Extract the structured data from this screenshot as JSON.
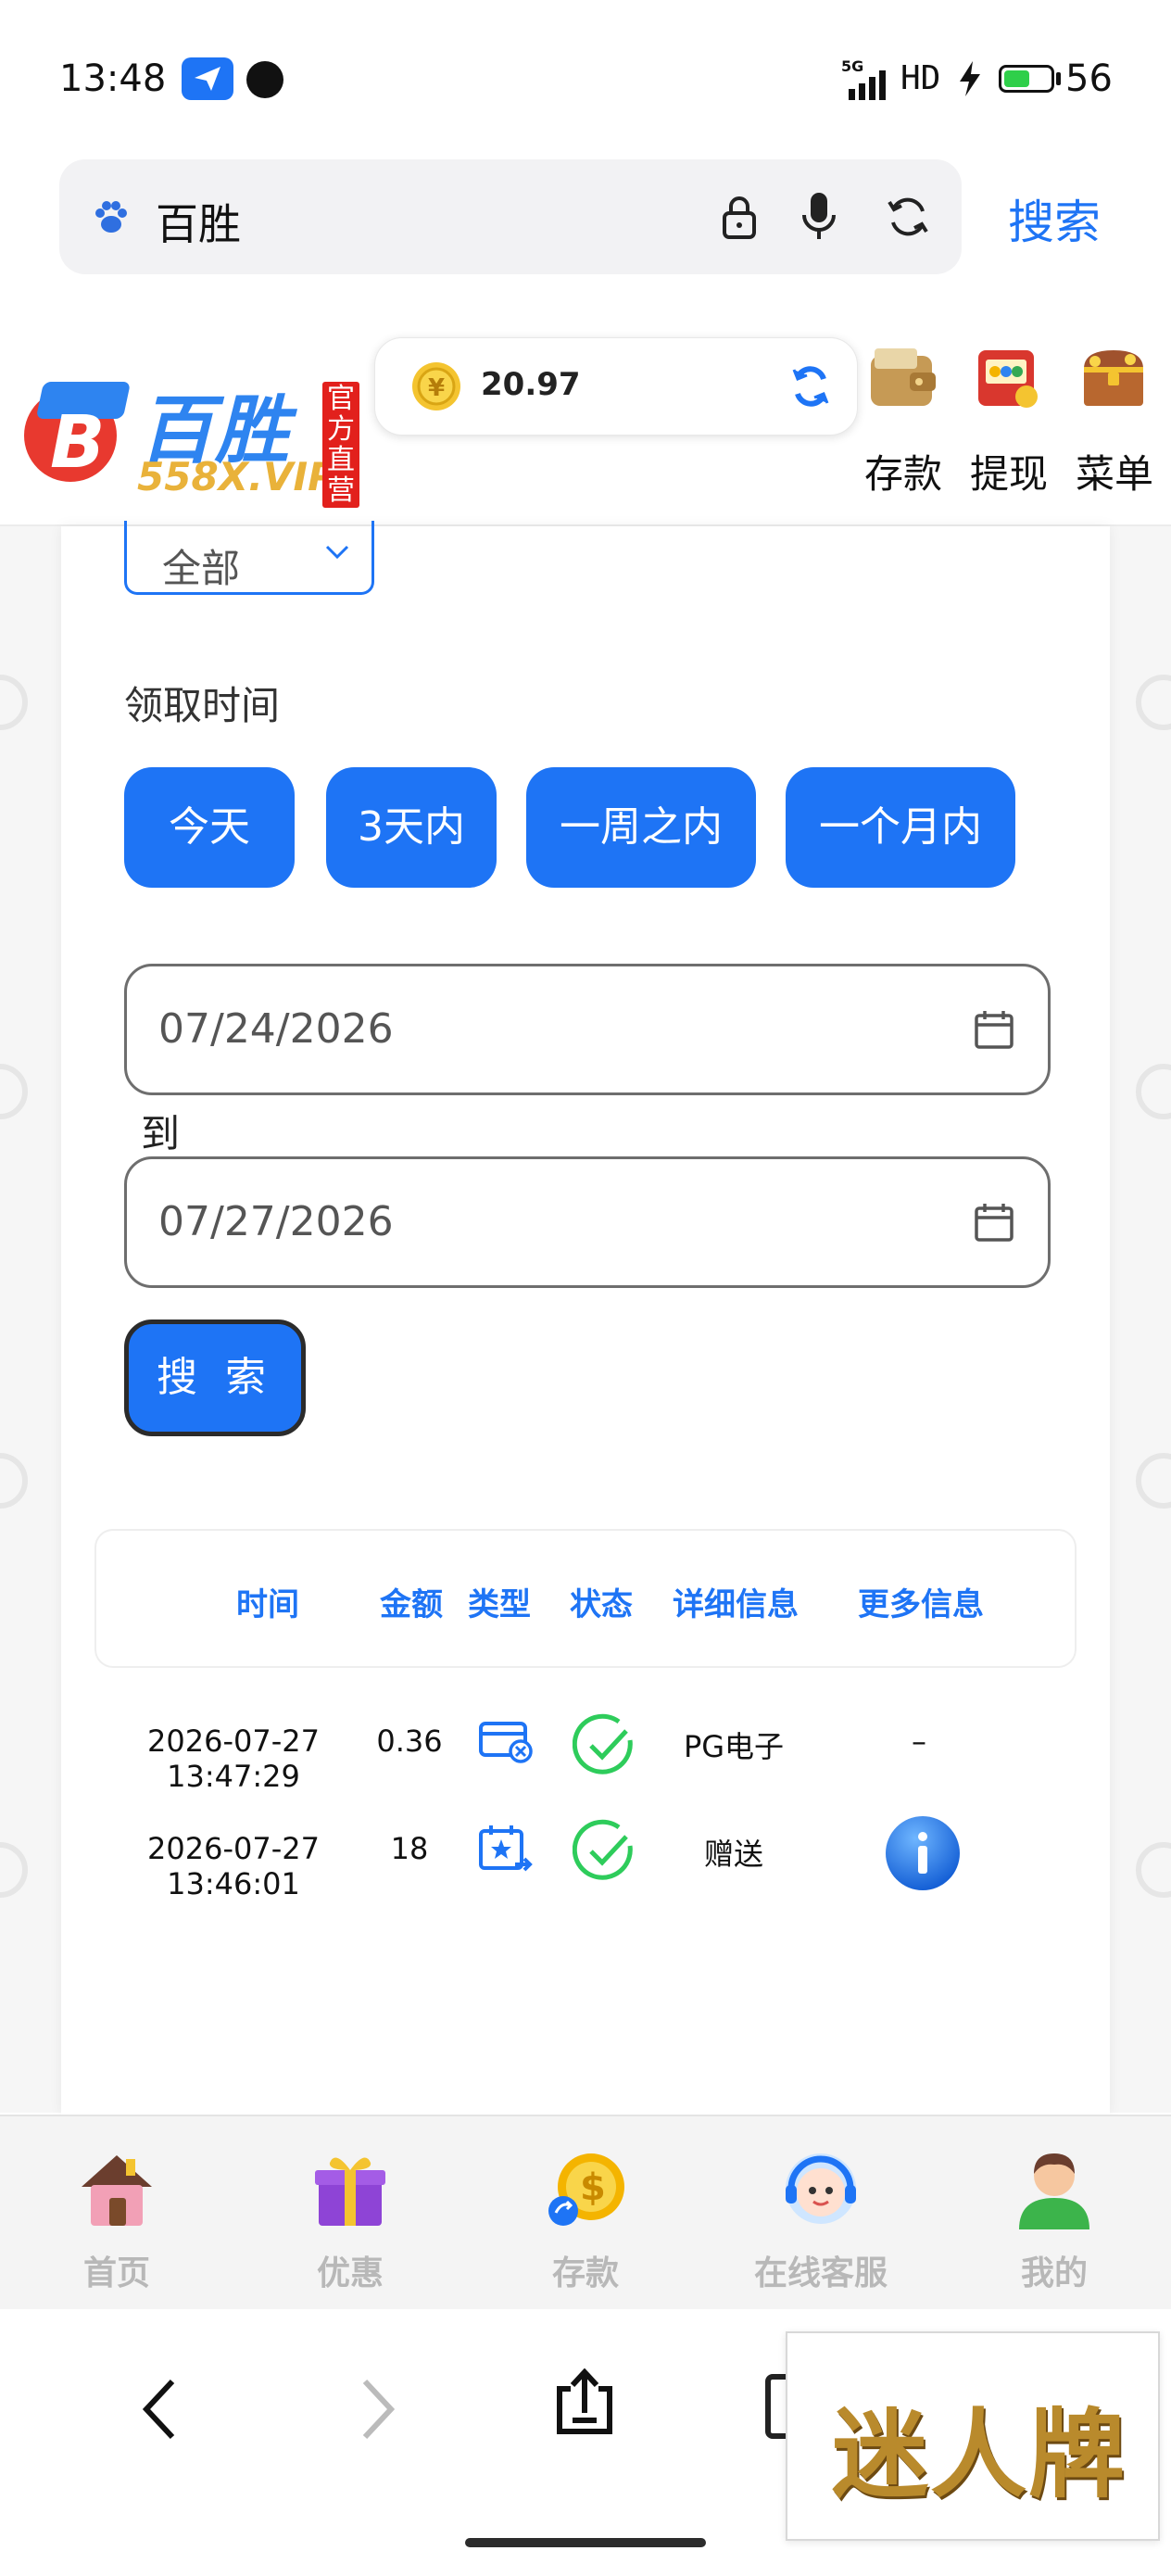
{
  "status_bar": {
    "time": "13:48",
    "network": "5G",
    "hd": "HD",
    "battery_level": "56",
    "battery_fraction": 0.56
  },
  "browser": {
    "search_text": "百胜",
    "search_button": "搜索"
  },
  "site_header": {
    "logo_main": "百胜",
    "logo_sub": "558X.VIP",
    "logo_tag": "官方直营",
    "balance": "20.97",
    "actions": [
      {
        "label": "存款",
        "icon": "wallet-icon"
      },
      {
        "label": "提现",
        "icon": "slot-machine-icon"
      },
      {
        "label": "菜单",
        "icon": "treasure-chest-icon"
      }
    ]
  },
  "filters": {
    "type_select_value": "全部",
    "time_label": "领取时间",
    "quick_ranges": [
      "今天",
      "3天内",
      "一周之内",
      "一个月内"
    ],
    "date_from": "07/24/2026",
    "to_label": "到",
    "date_to": "07/27/2026",
    "search_button": "搜 索"
  },
  "table": {
    "headers": [
      "时间",
      "金额",
      "类型",
      "状态",
      "详细信息",
      "更多信息"
    ],
    "rows": [
      {
        "time": "2026-07-27 13:47:29",
        "amount": "0.36",
        "type_icon": "card-cancel-icon",
        "status_icon": "check-circle-icon",
        "detail": "PG电子",
        "more": "–"
      },
      {
        "time": "2026-07-27 13:46:01",
        "amount": "18",
        "type_icon": "calendar-star-icon",
        "status_icon": "check-circle-icon",
        "detail": "赠送",
        "more_icon": "info-icon"
      }
    ]
  },
  "tab_bar": [
    {
      "label": "首页",
      "icon": "home-icon"
    },
    {
      "label": "优惠",
      "icon": "gift-icon"
    },
    {
      "label": "存款",
      "icon": "deposit-coin-icon"
    },
    {
      "label": "在线客服",
      "icon": "support-agent-icon"
    },
    {
      "label": "我的",
      "icon": "user-icon"
    }
  ],
  "ad": {
    "text": "迷人牌"
  },
  "colors": {
    "accent": "#1e74f5",
    "check_green": "#2ecc5b",
    "tab_inactive": "#b8b8b8"
  }
}
